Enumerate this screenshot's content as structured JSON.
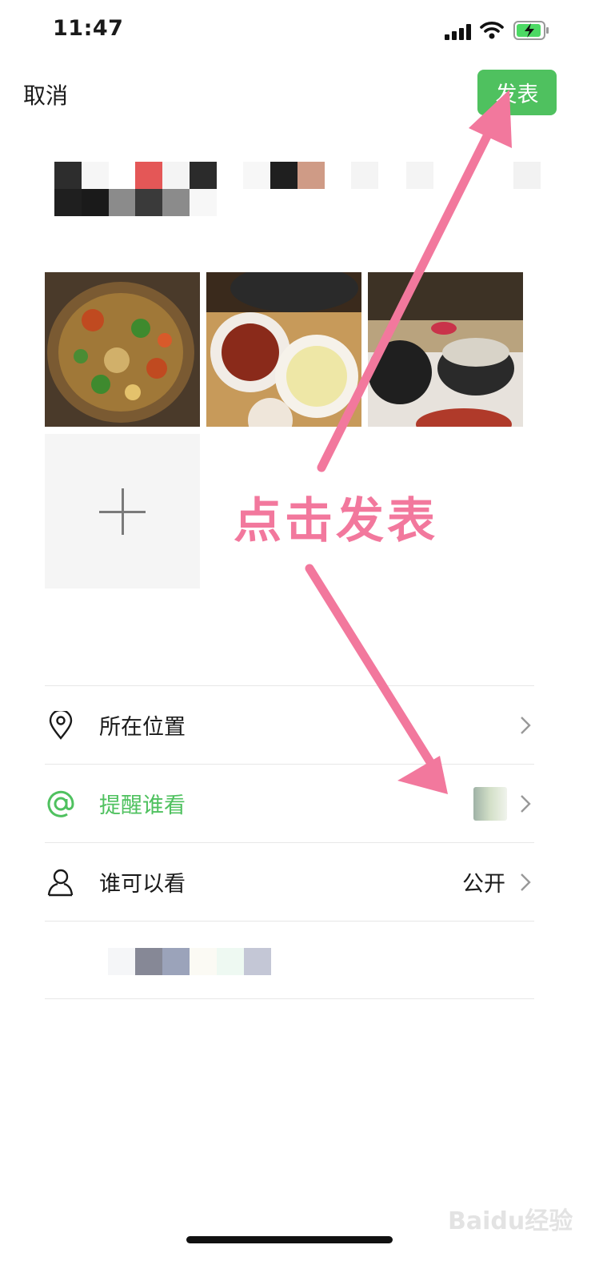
{
  "status_bar": {
    "time": "11:47"
  },
  "header": {
    "cancel_label": "取消",
    "publish_label": "发表"
  },
  "attachments": {
    "photos": [
      {
        "name": "seafood-pot"
      },
      {
        "name": "dry-pot-dishes"
      },
      {
        "name": "stone-pot-table"
      }
    ],
    "add_icon": "plus-icon"
  },
  "rows": [
    {
      "icon": "location-pin-icon",
      "label": "所在位置",
      "value": ""
    },
    {
      "icon": "at-icon",
      "label": "提醒谁看",
      "value": ""
    },
    {
      "icon": "person-icon",
      "label": "谁可以看",
      "value": "公开"
    }
  ],
  "annotation": {
    "text": "点击发表"
  },
  "watermark": {
    "text": "Baidu经验"
  },
  "colors": {
    "accent_green": "#4fc15f",
    "annotation_pink": "#f2789d"
  }
}
